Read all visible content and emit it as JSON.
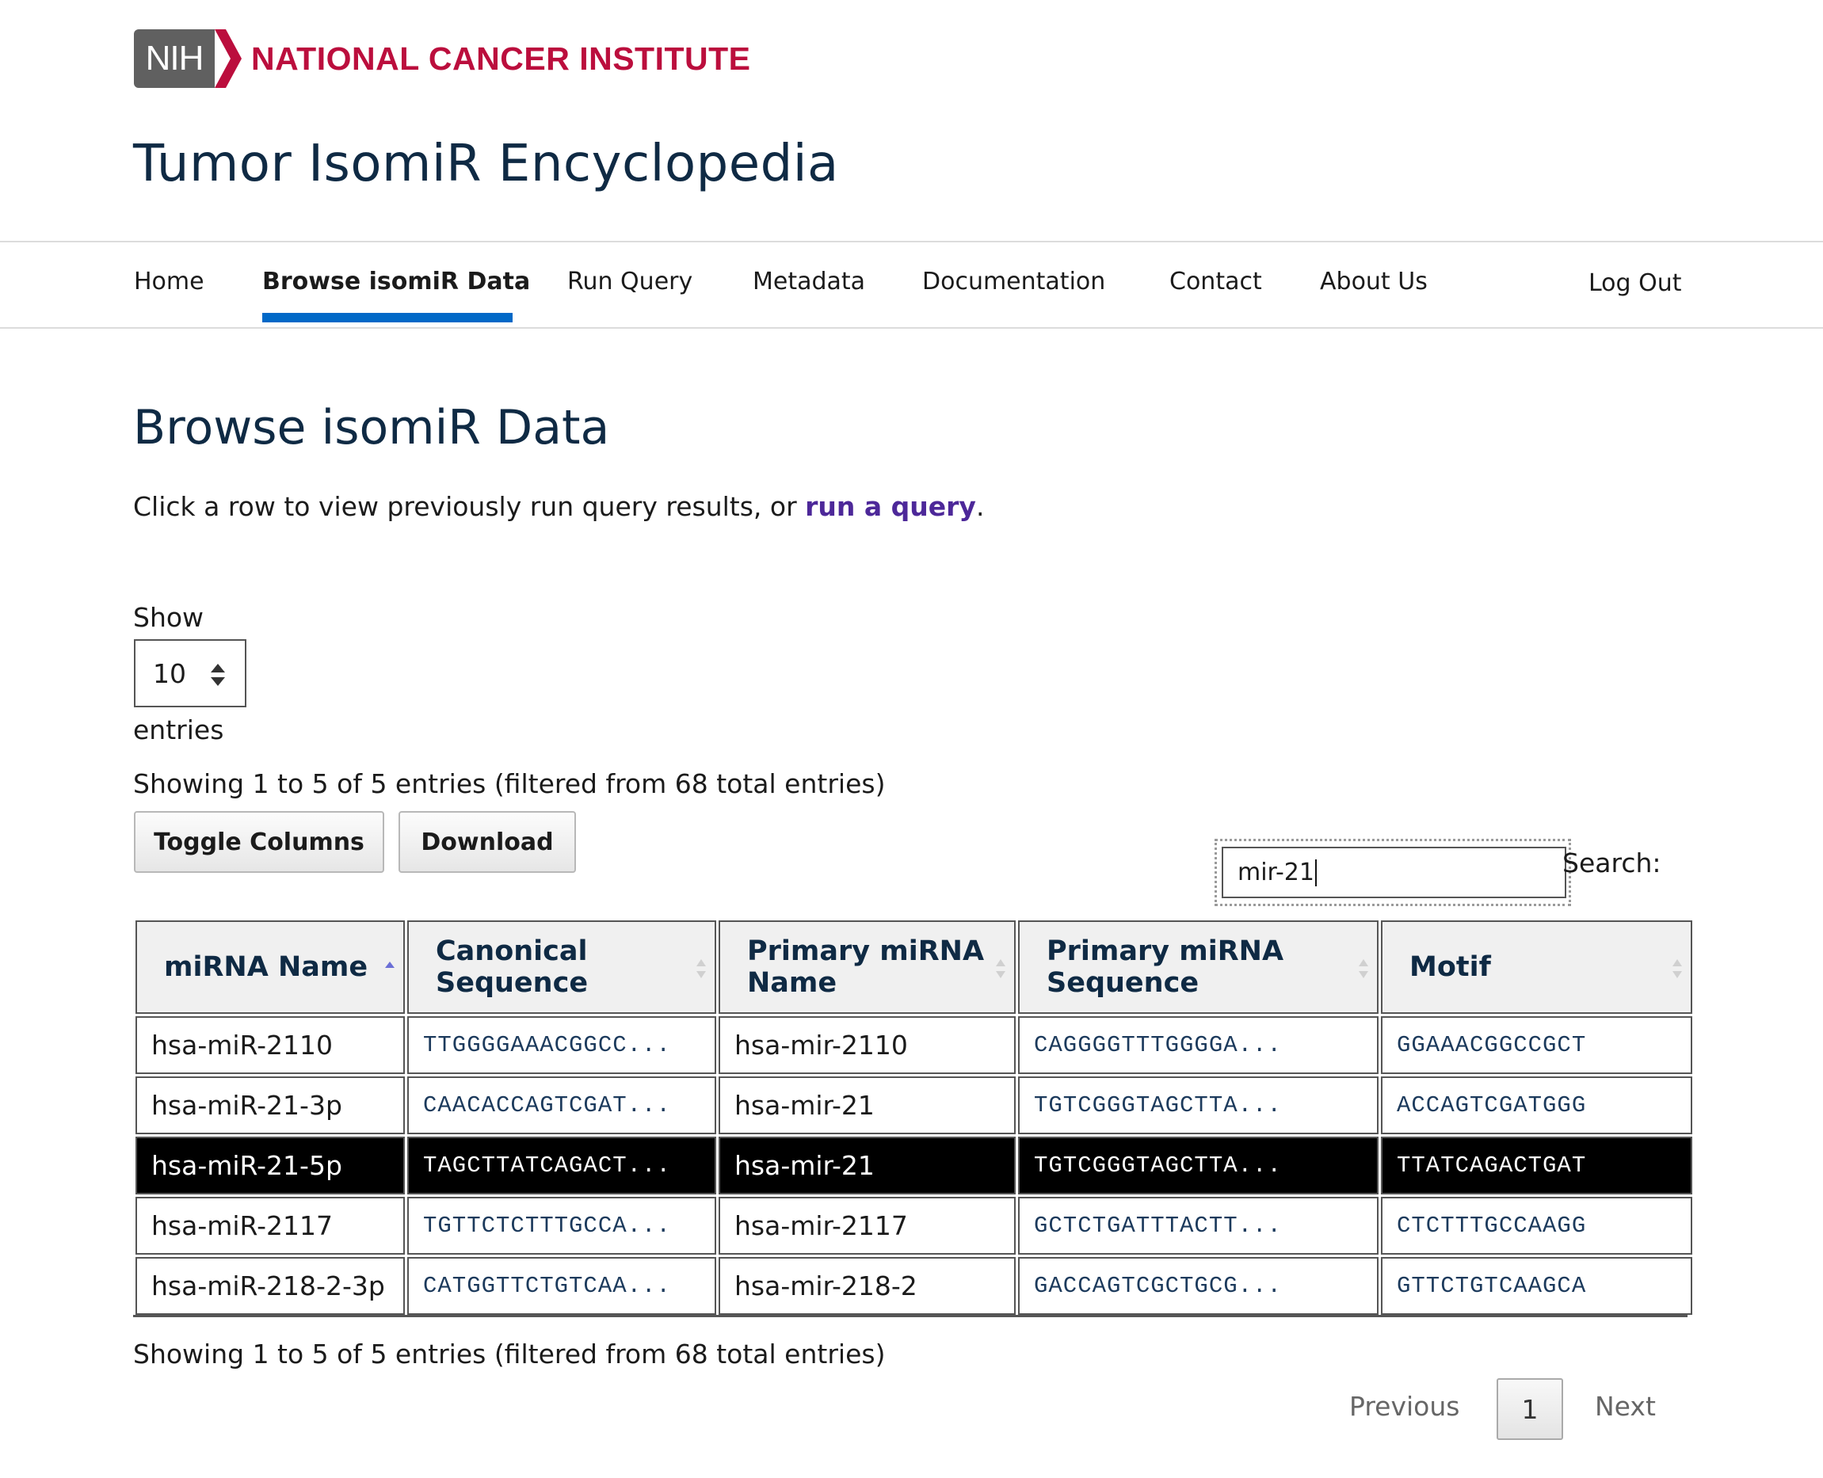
{
  "header": {
    "agency_logo": "NIH",
    "institute_name": "NATIONAL CANCER INSTITUTE",
    "site_title": "Tumor IsomiR Encyclopedia"
  },
  "nav": {
    "items": [
      "Home",
      "Browse isomiR Data",
      "Run Query",
      "Metadata",
      "Documentation",
      "Contact",
      "About Us"
    ],
    "active": "Browse isomiR Data",
    "logout": "Log Out"
  },
  "main": {
    "title": "Browse isomiR Data",
    "intro_text": "Click a row to view previously run query results, or ",
    "intro_link": "run a query",
    "intro_end": "."
  },
  "length": {
    "show_label": "Show",
    "value": "10",
    "entries_label": "entries"
  },
  "info": {
    "top": "Showing 1 to 5 of 5 entries (filtered from 68 total entries)",
    "bottom": "Showing 1 to 5 of 5 entries (filtered from 68 total entries)"
  },
  "buttons": {
    "toggle_columns": "Toggle Columns",
    "download": "Download"
  },
  "search": {
    "label": "Search:",
    "value": "mir-21"
  },
  "table": {
    "columns": [
      "miRNA Name",
      "Canonical Sequence",
      "Primary miRNA Name",
      "Primary miRNA Sequence",
      "Motif"
    ],
    "sorted_column": "miRNA Name",
    "sort_direction": "ascending",
    "rows": [
      [
        "hsa-miR-2110",
        "TTGGGGAAACGGCC...",
        "hsa-mir-2110",
        "CAGGGGTTTGGGGA...",
        "GGAAACGGCCGCT"
      ],
      [
        "hsa-miR-21-3p",
        "CAACACCAGTCGAT...",
        "hsa-mir-21",
        "TGTCGGGTAGCTTA...",
        "ACCAGTCGATGGG"
      ],
      [
        "hsa-miR-21-5p",
        "TAGCTTATCAGACT...",
        "hsa-mir-21",
        "TGTCGGGTAGCTTA...",
        "TTATCAGACTGAT"
      ],
      [
        "hsa-miR-2117",
        "TGTTCTCTTTGCCA...",
        "hsa-mir-2117",
        "GCTCTGATTTACTT...",
        "CTCTTTGCCAAGG"
      ],
      [
        "hsa-miR-218-2-3p",
        "CATGGTTCTGTCAA...",
        "hsa-mir-218-2",
        "GACCAGTCGCTGCG...",
        "GTTCTGTCAAGCA"
      ]
    ],
    "selected_row": 2
  },
  "pagination": {
    "previous": "Previous",
    "current_page": "1",
    "next": "Next"
  },
  "colors": {
    "nci_red": "#bb0e3d",
    "nih_gray": "#606060",
    "nav_active_blue": "#0068c7",
    "title_navy": "#0f2a44",
    "link_purple": "#4d2899",
    "selected_row_bg": "#000000"
  }
}
